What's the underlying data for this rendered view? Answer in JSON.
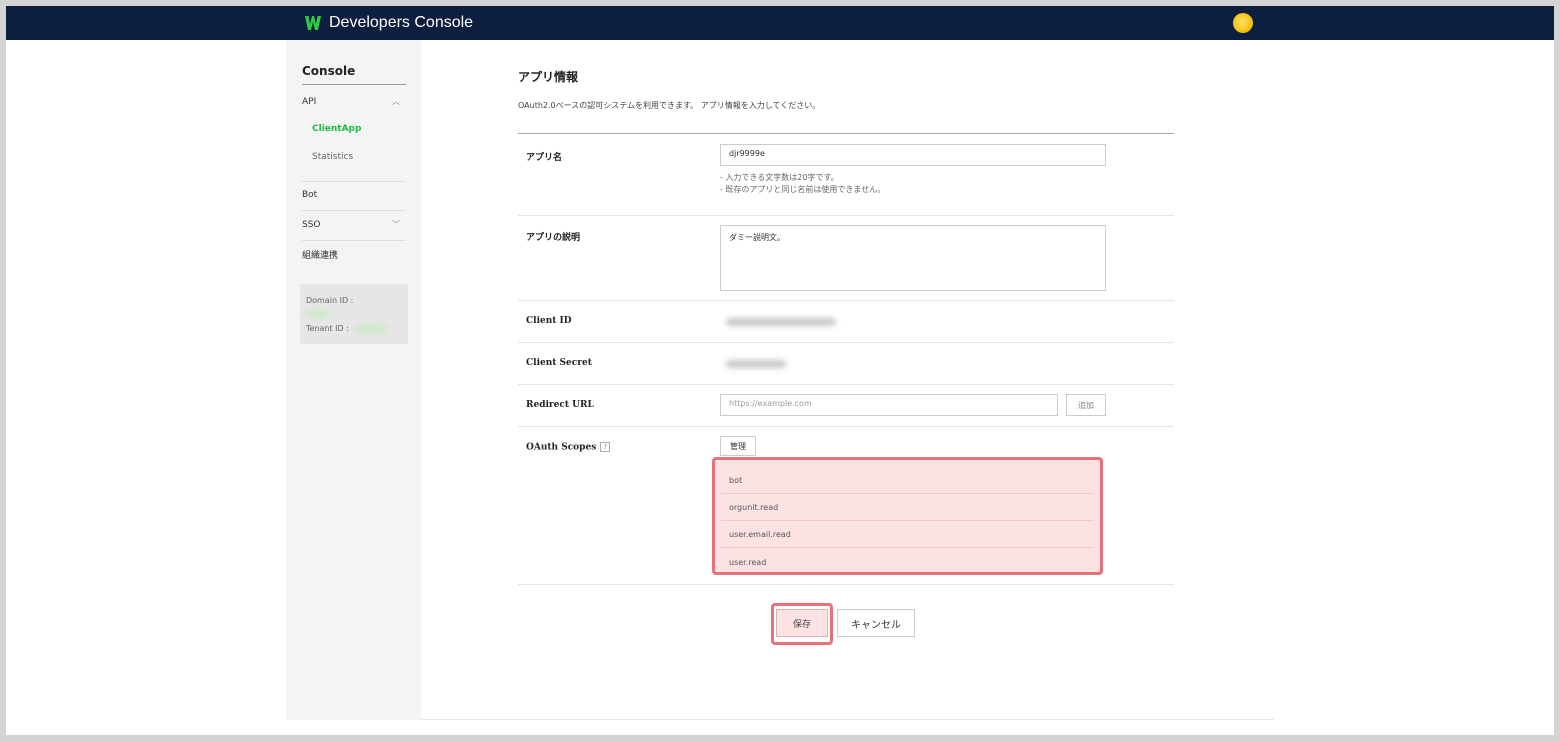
{
  "header": {
    "brand": "Developers Console"
  },
  "sidebar": {
    "title": "Console",
    "api": {
      "label": "API",
      "sub_items": [
        {
          "label": "ClientApp",
          "active": true
        },
        {
          "label": "Statistics",
          "active": false
        }
      ]
    },
    "bot": {
      "label": "Bot"
    },
    "sso": {
      "label": "SSO"
    },
    "org": {
      "label": "組織連携"
    },
    "ids": {
      "domain_label": "Domain ID :",
      "tenant_label": "Tenant ID :"
    }
  },
  "main": {
    "title": "アプリ情報",
    "description": "OAuth2.0ベースの認可システムを利用できます。 アプリ情報を入力してください。",
    "app_name": {
      "label": "アプリ名",
      "value": "djr9999e",
      "hints": [
        "- 入力できる文字数は20字です。",
        "- 既存のアプリと同じ名前は使用できません。"
      ]
    },
    "app_desc": {
      "label": "アプリの説明",
      "value": "ダミー説明文。"
    },
    "client_id": {
      "label": "Client ID"
    },
    "client_secret": {
      "label": "Client Secret"
    },
    "redirect_url": {
      "label": "Redirect URL",
      "placeholder": "https://example.com",
      "add_label": "追加"
    },
    "oauth_scopes": {
      "label": "OAuth Scopes",
      "help": "?",
      "manage_label": "管理",
      "scopes": [
        "bot",
        "orgunit.read",
        "user.email.read",
        "user.read"
      ]
    },
    "actions": {
      "save_label": "保存",
      "cancel_label": "キャンセル"
    }
  },
  "colors": {
    "header_bg": "#0e1e3f",
    "active_nav": "#1dbc45",
    "highlight": "#e8707a"
  }
}
